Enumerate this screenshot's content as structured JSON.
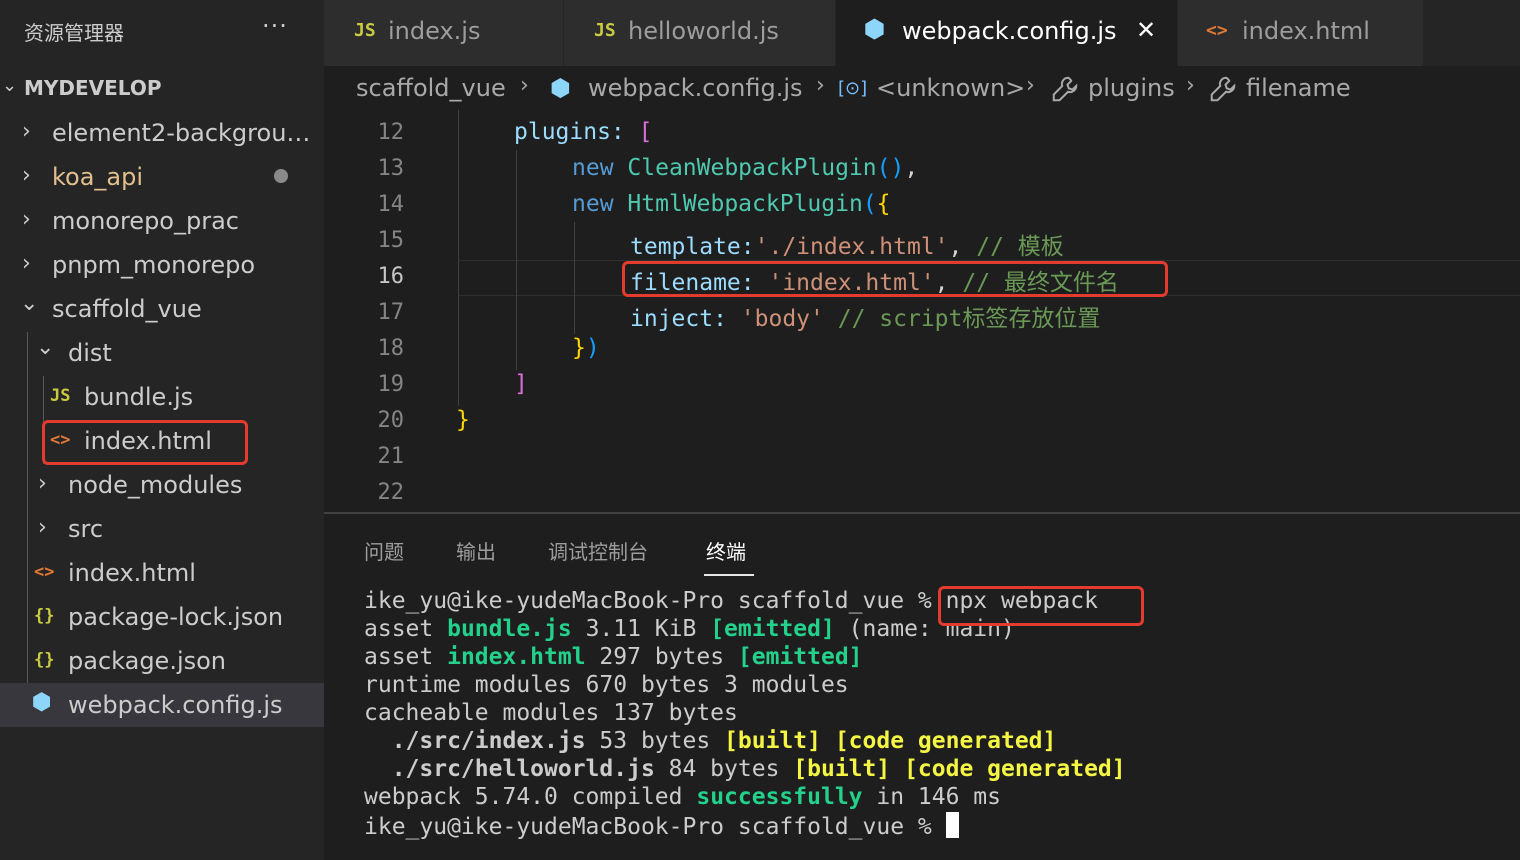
{
  "explorer": {
    "title": "资源管理器",
    "more": "···",
    "section": "MYDEVELOP",
    "items": [
      {
        "label": "element2-backgrou…",
        "kind": "folder"
      },
      {
        "label": "koa_api",
        "kind": "folder"
      },
      {
        "label": "monorepo_prac",
        "kind": "folder"
      },
      {
        "label": "pnpm_monorepo",
        "kind": "folder"
      },
      {
        "label": "scaffold_vue",
        "kind": "folder-open"
      },
      {
        "label": "dist",
        "kind": "folder-open"
      },
      {
        "label": "bundle.js",
        "kind": "js",
        "icon": "JS"
      },
      {
        "label": "index.html",
        "kind": "html",
        "icon": "<>"
      },
      {
        "label": "node_modules",
        "kind": "folder"
      },
      {
        "label": "src",
        "kind": "folder"
      },
      {
        "label": "index.html",
        "kind": "html",
        "icon": "<>"
      },
      {
        "label": "package-lock.json",
        "kind": "json",
        "icon": "{}"
      },
      {
        "label": "package.json",
        "kind": "json",
        "icon": "{}"
      },
      {
        "label": "webpack.config.js",
        "kind": "webpack",
        "icon": "⬢"
      }
    ]
  },
  "tabs": [
    {
      "label": "index.js",
      "icon": "JS"
    },
    {
      "label": "helloworld.js",
      "icon": "JS"
    },
    {
      "label": "webpack.config.js",
      "icon": "⬢",
      "close": "✕"
    },
    {
      "label": "index.html",
      "icon": "<>"
    }
  ],
  "breadcrumb": {
    "items": [
      "scaffold_vue",
      "webpack.config.js",
      "<unknown>",
      "plugins",
      "filename"
    ],
    "separator": "›",
    "icons": {
      "unknown": "[⊙]",
      "wrench": "🔧",
      "webpack": "⬢"
    }
  },
  "editor": {
    "line_numbers": [
      "12",
      "13",
      "14",
      "15",
      "16",
      "17",
      "18",
      "19",
      "20",
      "21",
      "22"
    ],
    "current_line": "16",
    "code": {
      "l12_prop": "plugins:",
      "l12_br": "[",
      "l13_kw": "new",
      "l13_cls": "CleanWebpackPlugin",
      "l13_paren": "()",
      "l13_comma": ",",
      "l14_kw": "new",
      "l14_cls": "HtmlWebpackPlugin",
      "l14_paren": "(",
      "l14_brace": "{",
      "l15_prop": "template:",
      "l15_str": "'./index.html'",
      "l15_comma": ",",
      "l15_cmt": "// 模板",
      "l16_prop": "filename:",
      "l16_str": "'index.html'",
      "l16_comma": ",",
      "l16_cmt": "// 最终文件名",
      "l17_prop": "inject:",
      "l17_str": "'body'",
      "l17_cmt": "// script标签存放位置",
      "l18_brace": "}",
      "l18_paren": ")",
      "l19_br": "]",
      "l20_brace": "}"
    }
  },
  "panel": {
    "tabs": [
      "问题",
      "输出",
      "调试控制台",
      "终端"
    ],
    "active_tab": "终端",
    "terminal": {
      "prompt": "ike_yu@ike-yudeMacBook-Pro scaffold_vue % ",
      "command": "npx webpack",
      "line2_a": "asset ",
      "line2_b": "bundle.js",
      "line2_c": " 3.11 KiB ",
      "line2_d": "[emitted]",
      "line2_e": " (name: main)",
      "line3_a": "asset ",
      "line3_b": "index.html",
      "line3_c": " 297 bytes ",
      "line3_d": "[emitted]",
      "line4": "runtime modules 670 bytes 3 modules",
      "line5": "cacheable modules 137 bytes",
      "line6_a": "  ./src/index.js",
      "line6_b": " 53 bytes ",
      "line6_c": "[built] [code generated]",
      "line7_a": "  ./src/helloworld.js",
      "line7_b": " 84 bytes ",
      "line7_c": "[built] [code generated]",
      "line8_a": "webpack 5.74.0 compiled ",
      "line8_b": "successfully",
      "line8_c": " in 146 ms",
      "prompt2": "ike_yu@ike-yudeMacBook-Pro scaffold_vue % "
    }
  },
  "colors": {
    "highlight_box": "#e33b2e",
    "js_icon": "#cbcb41",
    "html_icon": "#e37933",
    "json_icon": "#cbcb41",
    "webpack_icon": "#8dd6f9",
    "modified_folder": "#e2c08d",
    "terminal_green": "#23d18b",
    "terminal_yellow": "#f5f543"
  }
}
